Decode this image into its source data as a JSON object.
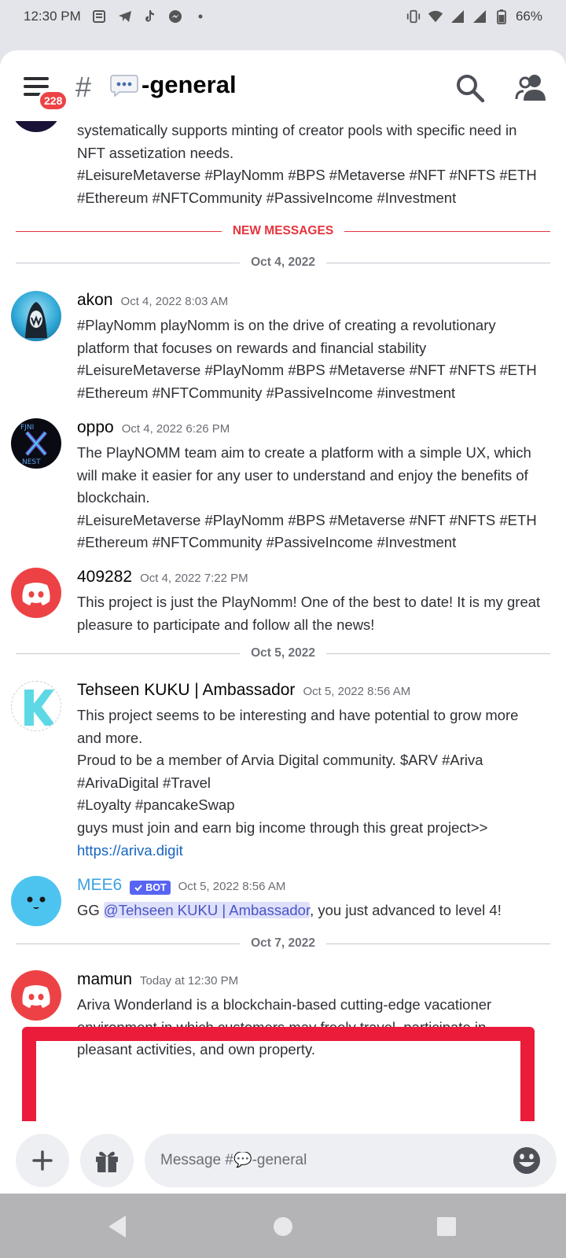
{
  "status_bar": {
    "time": "12:30 PM",
    "battery": "66%"
  },
  "header": {
    "badge": "228",
    "hash": "#",
    "channel": "-general"
  },
  "new_messages_label": "NEW MESSAGES",
  "top_fragment": {
    "lines": [
      "systematically supports minting of creator pools with specific need in",
      "NFT assetization needs.",
      "#LeisureMetaverse #PlayNomm #BPS #Metaverse #NFT #NFTS #ETH",
      "#Ethereum #NFTCommunity #PassiveIncome #Investment"
    ]
  },
  "dates": {
    "d1": "Oct 4, 2022",
    "d2": "Oct 5, 2022",
    "d3": "Oct 7, 2022"
  },
  "messages": [
    {
      "author": "akon",
      "timestamp": "Oct 4, 2022 8:03 AM",
      "lines": [
        "#PlayNomm playNomm is on the drive of creating a revolutionary",
        "platform that focuses on rewards and financial stability",
        "#LeisureMetaverse #PlayNomm #BPS #Metaverse #NFT #NFTS #ETH",
        "#Ethereum #NFTCommunity #PassiveIncome #investment"
      ]
    },
    {
      "author": "oppo",
      "timestamp": "Oct 4, 2022 6:26 PM",
      "lines": [
        "The PlayNOMM team aim to create a platform with a simple UX, which",
        "will make it easier for any user to understand and enjoy the benefits of",
        "blockchain.",
        "#LeisureMetaverse #PlayNomm #BPS #Metaverse #NFT #NFTS #ETH",
        "#Ethereum #NFTCommunity #PassiveIncome #Investment"
      ]
    },
    {
      "author": "409282",
      "timestamp": "Oct 4, 2022 7:22 PM",
      "lines": [
        "This project is just the PlayNomm! One of the best to date! It is my great",
        "pleasure to participate and follow all the news!"
      ]
    },
    {
      "author": "Tehseen KUKU | Ambassador",
      "timestamp": "Oct 5, 2022 8:56 AM",
      "lines": [
        "This project seems to be interesting and have potential to grow more",
        "and more.",
        "Proud to be a member of Arvia Digital community. $ARV #Ariva",
        "#ArivaDigital #Travel",
        "#Loyalty #pancakeSwap",
        "guys must join and earn big income through this great project>>"
      ],
      "link": "https://ariva.digit"
    },
    {
      "author": "MEE6",
      "bot_label": "BOT",
      "timestamp": "Oct 5, 2022 8:56 AM",
      "prefix": "GG ",
      "mention": "@Tehseen KUKU | Ambassador",
      "suffix": ", you just advanced to level 4!"
    },
    {
      "author": "mamun",
      "timestamp": "Today at 12:30 PM",
      "lines": [
        "Ariva Wonderland is a blockchain-based cutting-edge vacationer",
        "environment in which customers may freely travel, participate in",
        "pleasant activities, and own property."
      ]
    }
  ],
  "composer": {
    "placeholder": "Message #💬-general"
  },
  "colors": {
    "accent": "#5865f2",
    "new_messages": "#e5343e",
    "highlight_box": "#ea1c3a",
    "link": "#1664c0",
    "mee6_name": "#3da1e0"
  },
  "icons": [
    "hamburger-icon",
    "search-icon",
    "members-icon",
    "plus-icon",
    "gift-icon",
    "emoji-icon",
    "back-icon",
    "home-icon",
    "recents-icon"
  ]
}
